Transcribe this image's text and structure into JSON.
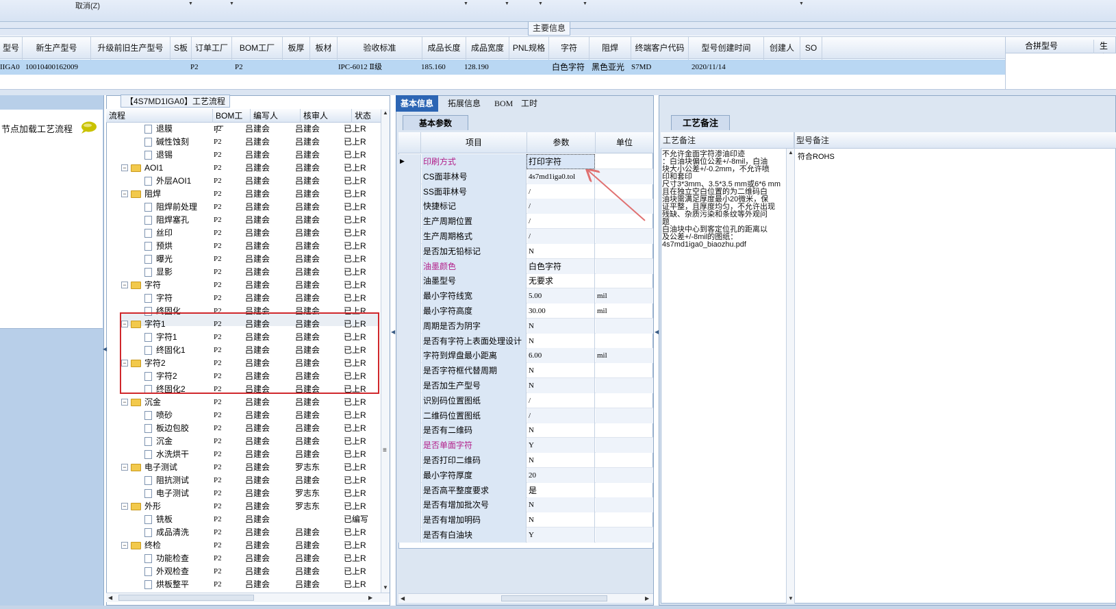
{
  "toolbar": {
    "cancel_label": "取消(Z)"
  },
  "main_info": {
    "title": "主要信息"
  },
  "header": {
    "columns": [
      "型号",
      "新生产型号",
      "升级前旧生产型号",
      "S板",
      "订单工厂",
      "BOM工厂",
      "板厚",
      "板材",
      "验收标准",
      "成品长度",
      "成品宽度",
      "PNL规格",
      "字符",
      "阻焊",
      "终端客户代码",
      "型号创建时间",
      "创建人",
      "SO"
    ],
    "row": {
      "model": "IIGA0",
      "new_model": "10010400162009",
      "old_model": "",
      "s_board": "",
      "order_factory": "P2",
      "bom_factory": "P2",
      "thickness": "",
      "material": "",
      "standard": "IPC-6012 Ⅱ级",
      "length": "185.160",
      "width": "128.190",
      "pnl": "",
      "char": "白色字符",
      "solder": "黑色亚光",
      "customer": "S7MD",
      "created": "2020/11/14",
      "creator": "",
      "so": ""
    }
  },
  "right_header": {
    "col1": "合拼型号",
    "col2": "生产"
  },
  "left": {
    "node_load_label": "节点加载工艺流程"
  },
  "tree": {
    "title": "【4S7MD1IGA0】工艺流程",
    "columns": {
      "flow": "流程",
      "bom": "BOM工厂",
      "author": "编写人",
      "reviewer": "核审人",
      "status": "状态"
    },
    "rows": [
      {
        "type": "doc",
        "name": "退膜",
        "bom": "P2",
        "author": "吕建会",
        "reviewer": "吕建会",
        "status": "已上R"
      },
      {
        "type": "doc",
        "name": "碱性蚀刻",
        "bom": "P2",
        "author": "吕建会",
        "reviewer": "吕建会",
        "status": "已上R"
      },
      {
        "type": "doc",
        "name": "退锡",
        "bom": "P2",
        "author": "吕建会",
        "reviewer": "吕建会",
        "status": "已上R"
      },
      {
        "type": "folder",
        "name": "AOI1",
        "bom": "P2",
        "author": "吕建会",
        "reviewer": "吕建会",
        "status": "已上R"
      },
      {
        "type": "doc",
        "name": "外层AOI1",
        "bom": "P2",
        "author": "吕建会",
        "reviewer": "吕建会",
        "status": "已上R"
      },
      {
        "type": "folder",
        "name": "阻焊",
        "bom": "P2",
        "author": "吕建会",
        "reviewer": "吕建会",
        "status": "已上R"
      },
      {
        "type": "doc",
        "name": "阻焊前处理",
        "bom": "P2",
        "author": "吕建会",
        "reviewer": "吕建会",
        "status": "已上R"
      },
      {
        "type": "doc",
        "name": "阻焊塞孔",
        "bom": "P2",
        "author": "吕建会",
        "reviewer": "吕建会",
        "status": "已上R"
      },
      {
        "type": "doc",
        "name": "丝印",
        "bom": "P2",
        "author": "吕建会",
        "reviewer": "吕建会",
        "status": "已上R"
      },
      {
        "type": "doc",
        "name": "预烘",
        "bom": "P2",
        "author": "吕建会",
        "reviewer": "吕建会",
        "status": "已上R"
      },
      {
        "type": "doc",
        "name": "曝光",
        "bom": "P2",
        "author": "吕建会",
        "reviewer": "吕建会",
        "status": "已上R"
      },
      {
        "type": "doc",
        "name": "显影",
        "bom": "P2",
        "author": "吕建会",
        "reviewer": "吕建会",
        "status": "已上R"
      },
      {
        "type": "folder",
        "name": "字符",
        "bom": "P2",
        "author": "吕建会",
        "reviewer": "吕建会",
        "status": "已上R"
      },
      {
        "type": "doc",
        "name": "字符",
        "bom": "P2",
        "author": "吕建会",
        "reviewer": "吕建会",
        "status": "已上R"
      },
      {
        "type": "doc",
        "name": "终固化",
        "bom": "P2",
        "author": "吕建会",
        "reviewer": "吕建会",
        "status": "已上R"
      },
      {
        "type": "folder",
        "name": "字符1",
        "bom": "P2",
        "author": "吕建会",
        "reviewer": "吕建会",
        "status": "已上R"
      },
      {
        "type": "doc",
        "name": "字符1",
        "bom": "P2",
        "author": "吕建会",
        "reviewer": "吕建会",
        "status": "已上R"
      },
      {
        "type": "doc",
        "name": "终固化1",
        "bom": "P2",
        "author": "吕建会",
        "reviewer": "吕建会",
        "status": "已上R"
      },
      {
        "type": "folder",
        "name": "字符2",
        "bom": "P2",
        "author": "吕建会",
        "reviewer": "吕建会",
        "status": "已上R"
      },
      {
        "type": "doc",
        "name": "字符2",
        "bom": "P2",
        "author": "吕建会",
        "reviewer": "吕建会",
        "status": "已上R"
      },
      {
        "type": "doc",
        "name": "终固化2",
        "bom": "P2",
        "author": "吕建会",
        "reviewer": "吕建会",
        "status": "已上R"
      },
      {
        "type": "folder",
        "name": "沉金",
        "bom": "P2",
        "author": "吕建会",
        "reviewer": "吕建会",
        "status": "已上R"
      },
      {
        "type": "doc",
        "name": "喷砂",
        "bom": "P2",
        "author": "吕建会",
        "reviewer": "吕建会",
        "status": "已上R"
      },
      {
        "type": "doc",
        "name": "板边包胶",
        "bom": "P2",
        "author": "吕建会",
        "reviewer": "吕建会",
        "status": "已上R"
      },
      {
        "type": "doc",
        "name": "沉金",
        "bom": "P2",
        "author": "吕建会",
        "reviewer": "吕建会",
        "status": "已上R"
      },
      {
        "type": "doc",
        "name": "水洗烘干",
        "bom": "P2",
        "author": "吕建会",
        "reviewer": "吕建会",
        "status": "已上R"
      },
      {
        "type": "folder",
        "name": "电子测试",
        "bom": "P2",
        "author": "吕建会",
        "reviewer": "罗志东",
        "status": "已上R"
      },
      {
        "type": "doc",
        "name": "阻抗测试",
        "bom": "P2",
        "author": "吕建会",
        "reviewer": "吕建会",
        "status": "已上R"
      },
      {
        "type": "doc",
        "name": "电子测试",
        "bom": "P2",
        "author": "吕建会",
        "reviewer": "罗志东",
        "status": "已上R"
      },
      {
        "type": "folder",
        "name": "外形",
        "bom": "P2",
        "author": "吕建会",
        "reviewer": "罗志东",
        "status": "已上R"
      },
      {
        "type": "doc",
        "name": "铣板",
        "bom": "P2",
        "author": "吕建会",
        "reviewer": "",
        "status": "已编写"
      },
      {
        "type": "doc",
        "name": "成品清洗",
        "bom": "P2",
        "author": "吕建会",
        "reviewer": "吕建会",
        "status": "已上R"
      },
      {
        "type": "folder",
        "name": "终检",
        "bom": "P2",
        "author": "吕建会",
        "reviewer": "吕建会",
        "status": "已上R"
      },
      {
        "type": "doc",
        "name": "功能检查",
        "bom": "P2",
        "author": "吕建会",
        "reviewer": "吕建会",
        "status": "已上R"
      },
      {
        "type": "doc",
        "name": "外观检查",
        "bom": "P2",
        "author": "吕建会",
        "reviewer": "吕建会",
        "status": "已上R"
      },
      {
        "type": "doc",
        "name": "烘板整平",
        "bom": "P2",
        "author": "吕建会",
        "reviewer": "吕建会",
        "status": "已上R"
      }
    ]
  },
  "tabs": [
    "基本信息",
    "拓展信息",
    "BOM",
    "工时"
  ],
  "basic": {
    "title": "基本参数",
    "columns": {
      "item": "项目",
      "param": "参数",
      "unit": "单位"
    },
    "rows": [
      {
        "item": "印刷方式",
        "param": "打印字符",
        "unit": "",
        "mag": true
      },
      {
        "item": "CS面菲林号",
        "param": "4s7md1iga0.tol",
        "unit": "",
        "mag": false
      },
      {
        "item": "SS面菲林号",
        "param": "/",
        "unit": "",
        "mag": false
      },
      {
        "item": "快捷标记",
        "param": "/",
        "unit": "",
        "mag": false
      },
      {
        "item": "生产周期位置",
        "param": "/",
        "unit": "",
        "mag": false
      },
      {
        "item": "生产周期格式",
        "param": "/",
        "unit": "",
        "mag": false
      },
      {
        "item": "是否加无铅标记",
        "param": "N",
        "unit": "",
        "mag": false
      },
      {
        "item": "油墨颜色",
        "param": "白色字符",
        "unit": "",
        "mag": true
      },
      {
        "item": "油墨型号",
        "param": "无要求",
        "unit": "",
        "mag": false
      },
      {
        "item": "最小字符线宽",
        "param": "5.00",
        "unit": "mil",
        "mag": false
      },
      {
        "item": "最小字符高度",
        "param": "30.00",
        "unit": "mil",
        "mag": false
      },
      {
        "item": "周期是否为阴字",
        "param": "N",
        "unit": "",
        "mag": false
      },
      {
        "item": "是否有字符上表面处理设计",
        "param": "N",
        "unit": "",
        "mag": false
      },
      {
        "item": "字符到焊盘最小距离",
        "param": "6.00",
        "unit": "mil",
        "mag": false
      },
      {
        "item": "是否字符框代替周期",
        "param": "N",
        "unit": "",
        "mag": false
      },
      {
        "item": "是否加生产型号",
        "param": "N",
        "unit": "",
        "mag": false
      },
      {
        "item": "识别码位置图纸",
        "param": "/",
        "unit": "",
        "mag": false
      },
      {
        "item": "二维码位置图纸",
        "param": "/",
        "unit": "",
        "mag": false
      },
      {
        "item": "是否有二维码",
        "param": "N",
        "unit": "",
        "mag": false
      },
      {
        "item": "是否单面字符",
        "param": "Y",
        "unit": "",
        "mag": true
      },
      {
        "item": "是否打印二维码",
        "param": "N",
        "unit": "",
        "mag": false
      },
      {
        "item": "最小字符厚度",
        "param": "20",
        "unit": "",
        "mag": false
      },
      {
        "item": "是否高平整度要求",
        "param": "是",
        "unit": "",
        "mag": false
      },
      {
        "item": "是否有增加批次号",
        "param": "N",
        "unit": "",
        "mag": false
      },
      {
        "item": "是否有增加明码",
        "param": "N",
        "unit": "",
        "mag": false
      },
      {
        "item": "是否有白油块",
        "param": "Y",
        "unit": "",
        "mag": false
      }
    ]
  },
  "notes": {
    "title": "工艺备注",
    "craft_col": "工艺备注",
    "model_col": "型号备注",
    "craft_text": "不允许金面字符渗油印迹\n：白油块偏位公差+/-8mil，白油\n块大小公差+/-0.2mm，不允许喷\n印和套印\n尺寸3*3mm、3.5*3.5 mm或6*6 mm\n且在独立空白位置的为二维码白\n油块需满足厚度最小20微米，保\n证平整，且厚度均匀，不允许出现\n残缺、杂质污染和条纹等外观问\n题\n白油块中心到客定位孔的距离以\n及公差+/-8mil的图纸：\n4s7md1iga0_biaozhu.pdf",
    "model_text": "符合ROHS"
  },
  "colors": {
    "accent": "#2c65b4",
    "selected_row": "#b9d7f3",
    "highlight_box": "#d0272b",
    "magenta_label": "#b2208a",
    "arrow": "#e07070"
  }
}
